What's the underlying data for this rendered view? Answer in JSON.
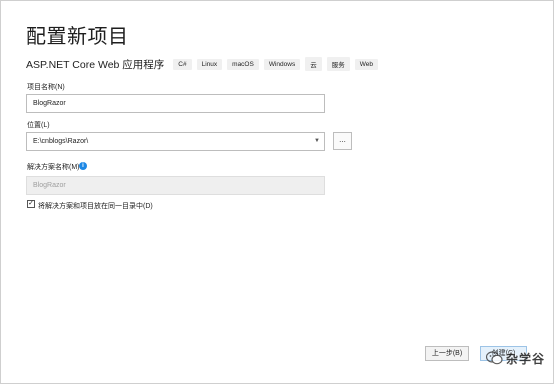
{
  "page": {
    "title": "配置新项目",
    "subtitle": "ASP.NET Core Web 应用程序",
    "tags": [
      "C#",
      "Linux",
      "macOS",
      "Windows",
      "云",
      "服务",
      "Web"
    ]
  },
  "form": {
    "project_name": {
      "label": "项目名称(N)",
      "value": "BlogRazor"
    },
    "location": {
      "label": "位置(L)",
      "value": "E:\\cnblogs\\Razor\\",
      "browse_label": "..."
    },
    "solution_name": {
      "label": "解决方案名称(M)",
      "value": "BlogRazor"
    },
    "same_dir": {
      "label": "将解决方案和项目放在同一目录中(D)",
      "checked": true
    }
  },
  "footer": {
    "back_label": "上一步(B)",
    "create_label": "创建(C)"
  },
  "watermark": {
    "text": "杂学谷"
  },
  "colors": {
    "info_icon": "#1e88e5",
    "primary_button_bg": "#e5f1fb"
  }
}
